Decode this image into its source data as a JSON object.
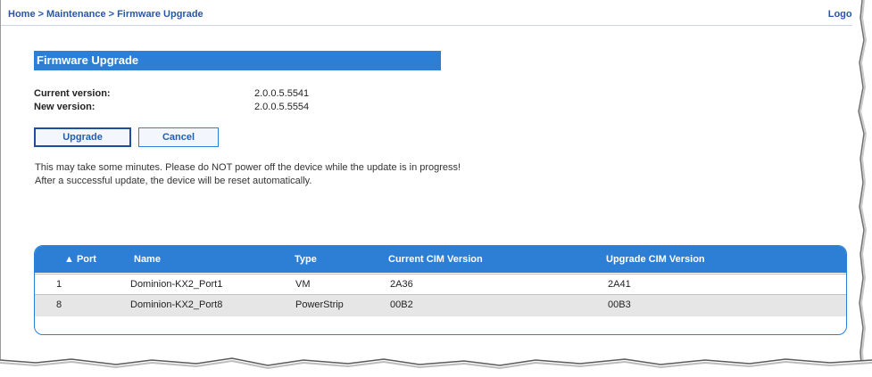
{
  "breadcrumb": {
    "items": [
      "Home",
      "Maintenance",
      "Firmware Upgrade"
    ],
    "separator": ">"
  },
  "logout_label": "Logout",
  "section_title": "Firmware Upgrade",
  "versions": {
    "current_label": "Current version:",
    "current_value": "2.0.0.5.5541",
    "new_label": "New version:",
    "new_value": "2.0.0.5.5554"
  },
  "buttons": {
    "upgrade": "Upgrade",
    "cancel": "Cancel"
  },
  "notice": "This may take some minutes. Please do NOT power off the device while the update is in progress! After a successful update, the device will be reset automatically.",
  "table": {
    "headers": [
      "▲ Port",
      "Name",
      "Type",
      "Current CIM Version",
      "Upgrade CIM Version"
    ],
    "rows": [
      {
        "port": "1",
        "name": "Dominion-KX2_Port1",
        "type": "VM",
        "current": "2A36",
        "upgrade": "2A41"
      },
      {
        "port": "8",
        "name": "Dominion-KX2_Port8",
        "type": "PowerStrip",
        "current": "00B2",
        "upgrade": "00B3"
      }
    ]
  },
  "colors": {
    "accent": "#2d7fd6",
    "link": "#2a56a6",
    "row_alt": "#e6e6e6"
  }
}
